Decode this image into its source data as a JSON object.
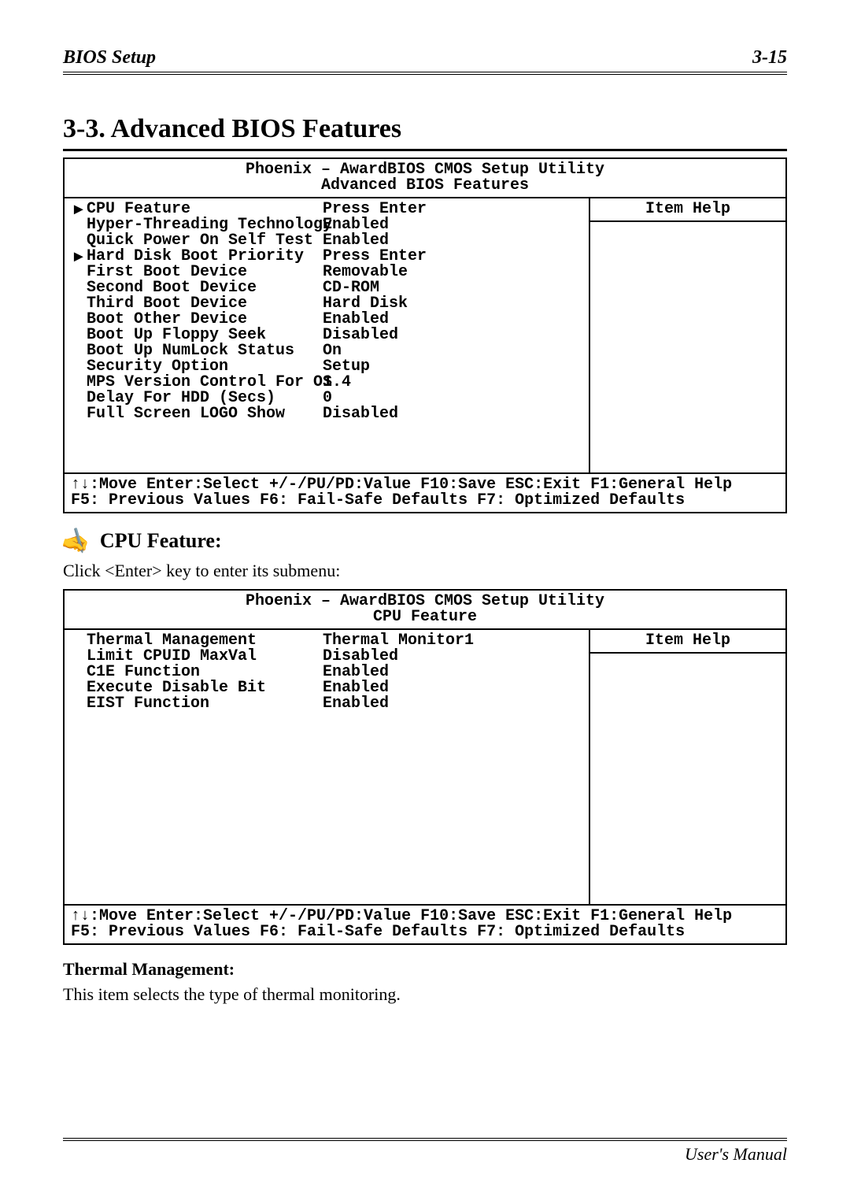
{
  "header": {
    "left": "BIOS Setup",
    "right": "3-15"
  },
  "section_title": "3-3.  Advanced BIOS Features",
  "bios1": {
    "title1": "Phoenix – AwardBIOS CMOS Setup Utility",
    "title2": "Advanced BIOS Features",
    "help_label": "Item Help",
    "rows": [
      {
        "marker": "►",
        "label": "CPU Feature",
        "value": "Press Enter"
      },
      {
        "marker": "",
        "label": "Hyper-Threading Technology",
        "value": "Enabled"
      },
      {
        "marker": "",
        "label": "Quick Power On Self Test",
        "value": "Enabled"
      },
      {
        "marker": "►",
        "label": "Hard Disk Boot Priority",
        "value": "Press Enter"
      },
      {
        "marker": "",
        "label": "First Boot Device",
        "value": "Removable"
      },
      {
        "marker": "",
        "label": "Second Boot Device",
        "value": "CD-ROM"
      },
      {
        "marker": "",
        "label": "Third Boot Device",
        "value": "Hard Disk"
      },
      {
        "marker": "",
        "label": "Boot Other Device",
        "value": "Enabled"
      },
      {
        "marker": "",
        "label": "Boot Up Floppy Seek",
        "value": "Disabled"
      },
      {
        "marker": "",
        "label": "Boot Up NumLock Status",
        "value": "On"
      },
      {
        "marker": "",
        "label": "Security Option",
        "value": "Setup"
      },
      {
        "marker": "",
        "label": "MPS Version Control For OS",
        "value": "1.4"
      },
      {
        "marker": "",
        "label": "Delay For HDD (Secs)",
        "value": "0"
      },
      {
        "marker": "",
        "label": "Full Screen LOGO Show",
        "value": "Disabled"
      }
    ],
    "footer1": "↑↓:Move Enter:Select +/-/PU/PD:Value F10:Save ESC:Exit F1:General Help",
    "footer2": "F5: Previous Values   F6: Fail-Safe Defaults   F7: Optimized Defaults"
  },
  "sub1": {
    "icon": "✍",
    "title": "CPU Feature:",
    "desc": "Click <Enter> key to enter its submenu:"
  },
  "bios2": {
    "title1": "Phoenix – AwardBIOS CMOS Setup Utility",
    "title2": "CPU Feature",
    "help_label": "Item Help",
    "rows": [
      {
        "marker": "",
        "label": "Thermal Management",
        "value": "Thermal Monitor1"
      },
      {
        "marker": "",
        "label": "Limit CPUID MaxVal",
        "value": "Disabled"
      },
      {
        "marker": "",
        "label": "C1E Function",
        "value": "Enabled"
      },
      {
        "marker": "",
        "label": "Execute Disable Bit",
        "value": "Enabled"
      },
      {
        "marker": "",
        "label": "EIST Function",
        "value": "Enabled"
      }
    ],
    "footer1": "↑↓:Move Enter:Select +/-/PU/PD:Value F10:Save ESC:Exit F1:General Help",
    "footer2": "F5: Previous Values   F6: Fail-Safe Defaults   F7: Optimized Defaults"
  },
  "item1": {
    "title": "Thermal Management:",
    "desc": "This item selects the type of thermal monitoring."
  },
  "footer": "User's Manual"
}
